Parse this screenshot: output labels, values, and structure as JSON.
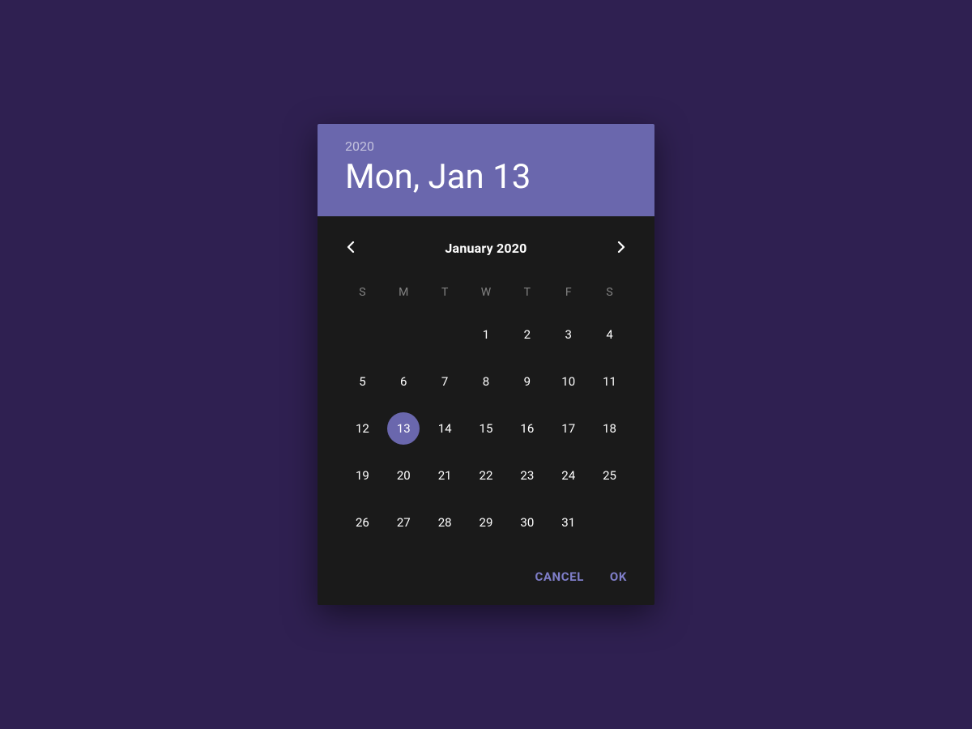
{
  "colors": {
    "accent": "#6a67ad",
    "page_bg": "#2f2051",
    "panel_bg": "#1a1a1a"
  },
  "header": {
    "year": "2020",
    "selected_date_label": "Mon, Jan 13"
  },
  "nav": {
    "month_label": "January 2020",
    "prev_icon": "chevron-left",
    "next_icon": "chevron-right"
  },
  "weekdays": [
    "S",
    "M",
    "T",
    "W",
    "T",
    "F",
    "S"
  ],
  "month": {
    "leading_blanks": 3,
    "days": [
      1,
      2,
      3,
      4,
      5,
      6,
      7,
      8,
      9,
      10,
      11,
      12,
      13,
      14,
      15,
      16,
      17,
      18,
      19,
      20,
      21,
      22,
      23,
      24,
      25,
      26,
      27,
      28,
      29,
      30,
      31
    ],
    "selected_day": 13
  },
  "actions": {
    "cancel_label": "CANCEL",
    "ok_label": "OK"
  }
}
